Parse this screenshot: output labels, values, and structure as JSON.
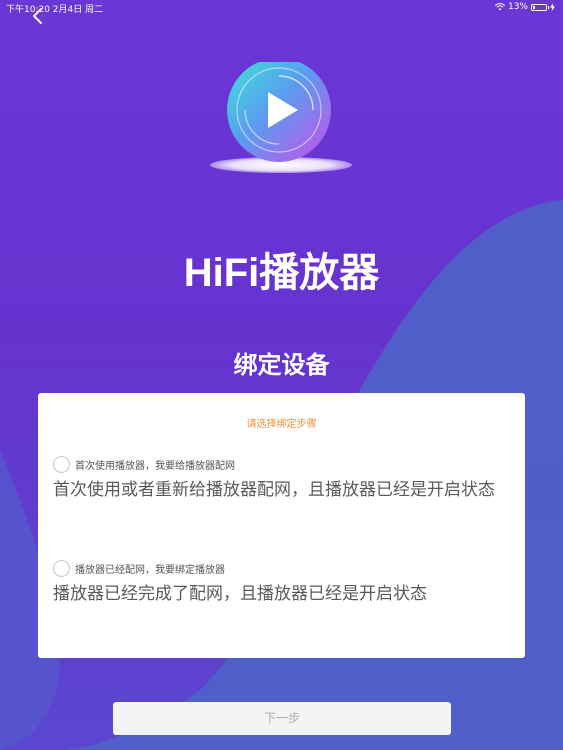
{
  "status_bar": {
    "left": "下午10:20   2月4日 周二",
    "battery_text": "13%",
    "battery_level": 0.13
  },
  "app_title": "HiFi播放器",
  "page_subtitle": "绑定设备",
  "card": {
    "hint": "请选择绑定步骤",
    "options": [
      {
        "label": "首次使用播放器，我要给播放器配网",
        "description": "首次使用或者重新给播放器配网，且播放器已经是开启状态"
      },
      {
        "label": "播放器已经配网，我要绑定播放器",
        "description": "播放器已经完成了配网，且播放器已经是开启状态"
      }
    ]
  },
  "next_button": "下一步",
  "icons": [
    "back-arrow-icon",
    "wifi-icon",
    "battery-icon",
    "play-icon"
  ],
  "colors": {
    "background": "#6633cf",
    "accent": "#f0913c",
    "wave": "#4f62c8"
  }
}
